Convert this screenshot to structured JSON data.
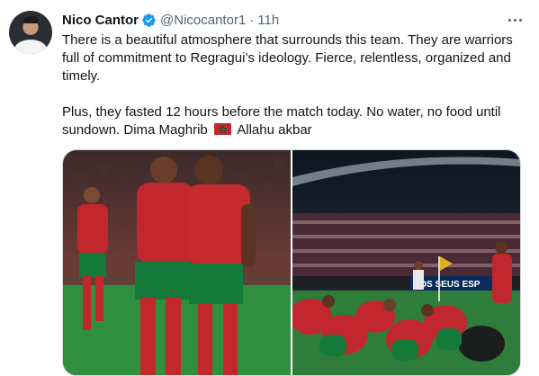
{
  "tweet": {
    "author_name": "Nico Cantor",
    "author_handle": "@Nicocantor1",
    "separator": "·",
    "time": "11h",
    "paragraph_1": "There is a beautiful atmosphere that surrounds this team. They are warriors full of commitment to Regragui’s ideology. Fierce, relentless, organized and timely.",
    "paragraph_2_before_flag": "Plus, they fasted 12 hours before the match today. No water, no food until sundown. Dima Maghrib",
    "paragraph_2_after_flag": "Allahu akbar"
  },
  "media": {
    "photo_1_icon": "celebration-photo",
    "photo_2_icon": "stadium-prayer-photo",
    "board_text": "NOS SEUS ESP"
  },
  "colors": {
    "verified": "#1d9bf0",
    "text_primary": "#0f1419",
    "text_secondary": "#536471",
    "morocco_red": "#c1272d",
    "morocco_green": "#006233"
  }
}
